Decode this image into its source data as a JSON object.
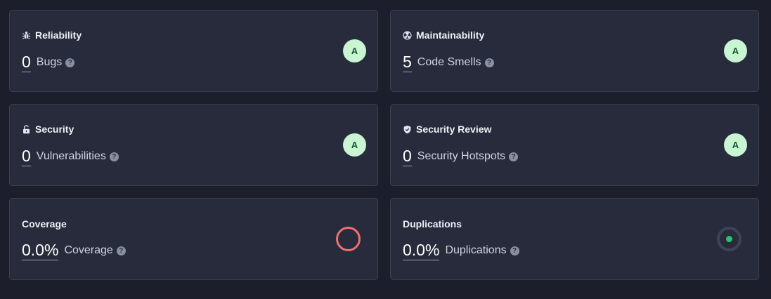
{
  "colors": {
    "background": "#1c1f2b",
    "card": "#272b3c",
    "grade_bg": "#c9f5d3",
    "grade_fg": "#115a2c",
    "coverage_ring": "#ee7170",
    "duplication_dot": "#26c56a"
  },
  "reliability": {
    "title": "Reliability",
    "icon": "bug-icon",
    "value": "0",
    "label": "Bugs",
    "help": "?",
    "grade": "A"
  },
  "maintainability": {
    "title": "Maintainability",
    "icon": "radiation-icon",
    "value": "5",
    "label": "Code Smells",
    "help": "?",
    "grade": "A"
  },
  "security": {
    "title": "Security",
    "icon": "unlock-icon",
    "value": "0",
    "label": "Vulnerabilities",
    "help": "?",
    "grade": "A"
  },
  "security_review": {
    "title": "Security Review",
    "icon": "shield-icon",
    "value": "0",
    "label": "Security Hotspots",
    "help": "?",
    "grade": "A"
  },
  "coverage": {
    "title": "Coverage",
    "value": "0.0%",
    "label": "Coverage",
    "help": "?",
    "indicator": "coverage-ring-icon"
  },
  "duplications": {
    "title": "Duplications",
    "value": "0.0%",
    "label": "Duplications",
    "help": "?",
    "indicator": "duplication-ring-icon"
  }
}
